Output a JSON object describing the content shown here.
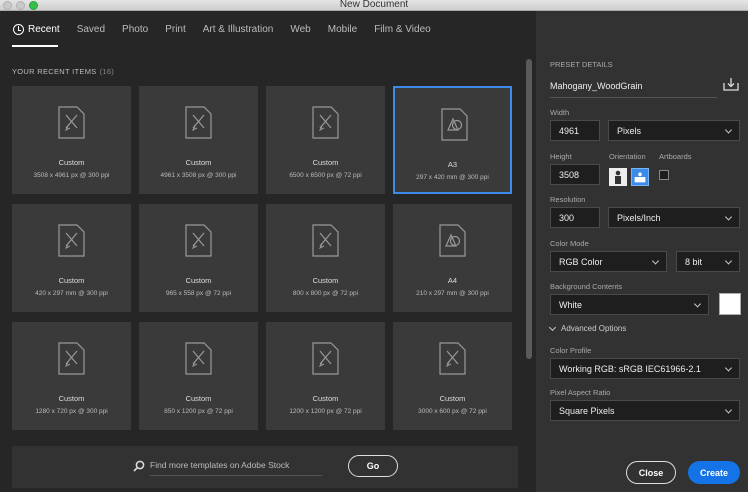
{
  "window": {
    "title": "New Document"
  },
  "tabs": [
    {
      "label": "Recent"
    },
    {
      "label": "Saved"
    },
    {
      "label": "Photo"
    },
    {
      "label": "Print"
    },
    {
      "label": "Art & Illustration"
    },
    {
      "label": "Web"
    },
    {
      "label": "Mobile"
    },
    {
      "label": "Film & Video"
    }
  ],
  "recent": {
    "title": "YOUR RECENT ITEMS",
    "count": "(16)",
    "items": [
      {
        "name": "Custom",
        "size": "3508 x 4961 px @ 300 ppi",
        "icon": "custom-doc-icon"
      },
      {
        "name": "Custom",
        "size": "4961 x 3508 px @ 300 ppi",
        "icon": "custom-doc-icon"
      },
      {
        "name": "Custom",
        "size": "6500 x 6500 px @ 72 ppi",
        "icon": "custom-doc-icon"
      },
      {
        "name": "A3",
        "size": "297 x 420 mm @ 300 ppi",
        "icon": "print-doc-icon",
        "selected": true
      },
      {
        "name": "Custom",
        "size": "420 x 297 mm @ 300 ppi",
        "icon": "custom-doc-icon"
      },
      {
        "name": "Custom",
        "size": "965 x 558 px @ 72 ppi",
        "icon": "custom-doc-icon"
      },
      {
        "name": "Custom",
        "size": "800 x 800 px @ 72 ppi",
        "icon": "custom-doc-icon"
      },
      {
        "name": "A4",
        "size": "210 x 297 mm @ 300 ppi",
        "icon": "print-doc-icon"
      },
      {
        "name": "Custom",
        "size": "1280 x 720 px @ 300 ppi",
        "icon": "custom-doc-icon"
      },
      {
        "name": "Custom",
        "size": "850 x 1200 px @ 72 ppi",
        "icon": "custom-doc-icon"
      },
      {
        "name": "Custom",
        "size": "1200 x 1200 px @ 72 ppi",
        "icon": "custom-doc-icon"
      },
      {
        "name": "Custom",
        "size": "3000 x 600 px @ 72 ppi",
        "icon": "custom-doc-icon"
      }
    ]
  },
  "stock": {
    "placeholder": "Find more templates on Adobe Stock",
    "go_label": "Go"
  },
  "preset": {
    "header": "PRESET DETAILS",
    "name": "Mahogany_WoodGrain",
    "width_label": "Width",
    "width_value": "4961",
    "width_unit": "Pixels",
    "height_label": "Height",
    "height_value": "3508",
    "orientation_label": "Orientation",
    "orientation_selected": "landscape",
    "artboards_label": "Artboards",
    "artboards_checked": false,
    "resolution_label": "Resolution",
    "resolution_value": "300",
    "resolution_unit": "Pixels/Inch",
    "color_mode_label": "Color Mode",
    "color_mode_value": "RGB Color",
    "bit_depth": "8 bit",
    "background_label": "Background Contents",
    "background_value": "White",
    "background_color": "#ffffff",
    "advanced_label": "Advanced Options",
    "profile_label": "Color Profile",
    "profile_value": "Working RGB: sRGB IEC61966-2.1",
    "aspect_label": "Pixel Aspect Ratio",
    "aspect_value": "Square Pixels"
  },
  "actions": {
    "close_label": "Close",
    "create_label": "Create"
  },
  "colors": {
    "accent": "#1473e6",
    "selection": "#3d8be8"
  }
}
